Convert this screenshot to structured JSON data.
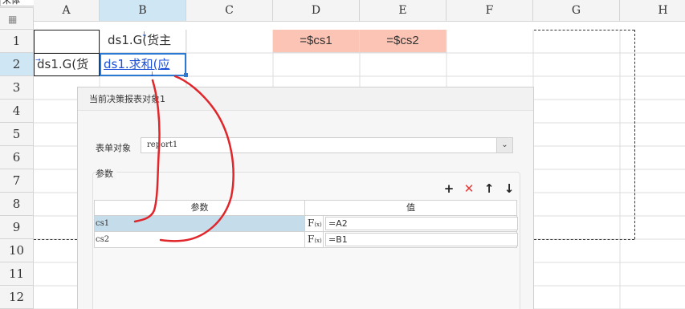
{
  "toolbar": {
    "font_name": "宋体"
  },
  "grid": {
    "columns": [
      "A",
      "B",
      "C",
      "D",
      "E",
      "F",
      "G",
      "H"
    ],
    "rows": [
      "1",
      "2",
      "3",
      "4",
      "5",
      "6",
      "7",
      "8",
      "9",
      "10",
      "11",
      "12"
    ],
    "selected_cell": "B2",
    "cells": {
      "B1": "ds1.G(货主",
      "A2": "ds1.G(货",
      "B2": "ds1.求和(应",
      "D1": "=$cs1",
      "E1": "=$cs2"
    },
    "colors": {
      "param_cell_bg": "#fbc4b4",
      "selection": "#2a7ad3",
      "header_selected": "#cfe6f5"
    }
  },
  "dialog": {
    "title": "当前决策报表对象1",
    "form_label": "表单对象",
    "form_value": "report1",
    "params_title": "参数",
    "buttons": {
      "add": "+",
      "delete": "✕",
      "up": "↑",
      "down": "↓"
    },
    "table": {
      "headers": [
        "参数",
        "值"
      ],
      "rows": [
        {
          "name": "cs1",
          "value": "=A2",
          "selected": true
        },
        {
          "name": "cs2",
          "value": "=B1",
          "selected": false
        }
      ]
    },
    "formula_icon": "F(x)"
  }
}
